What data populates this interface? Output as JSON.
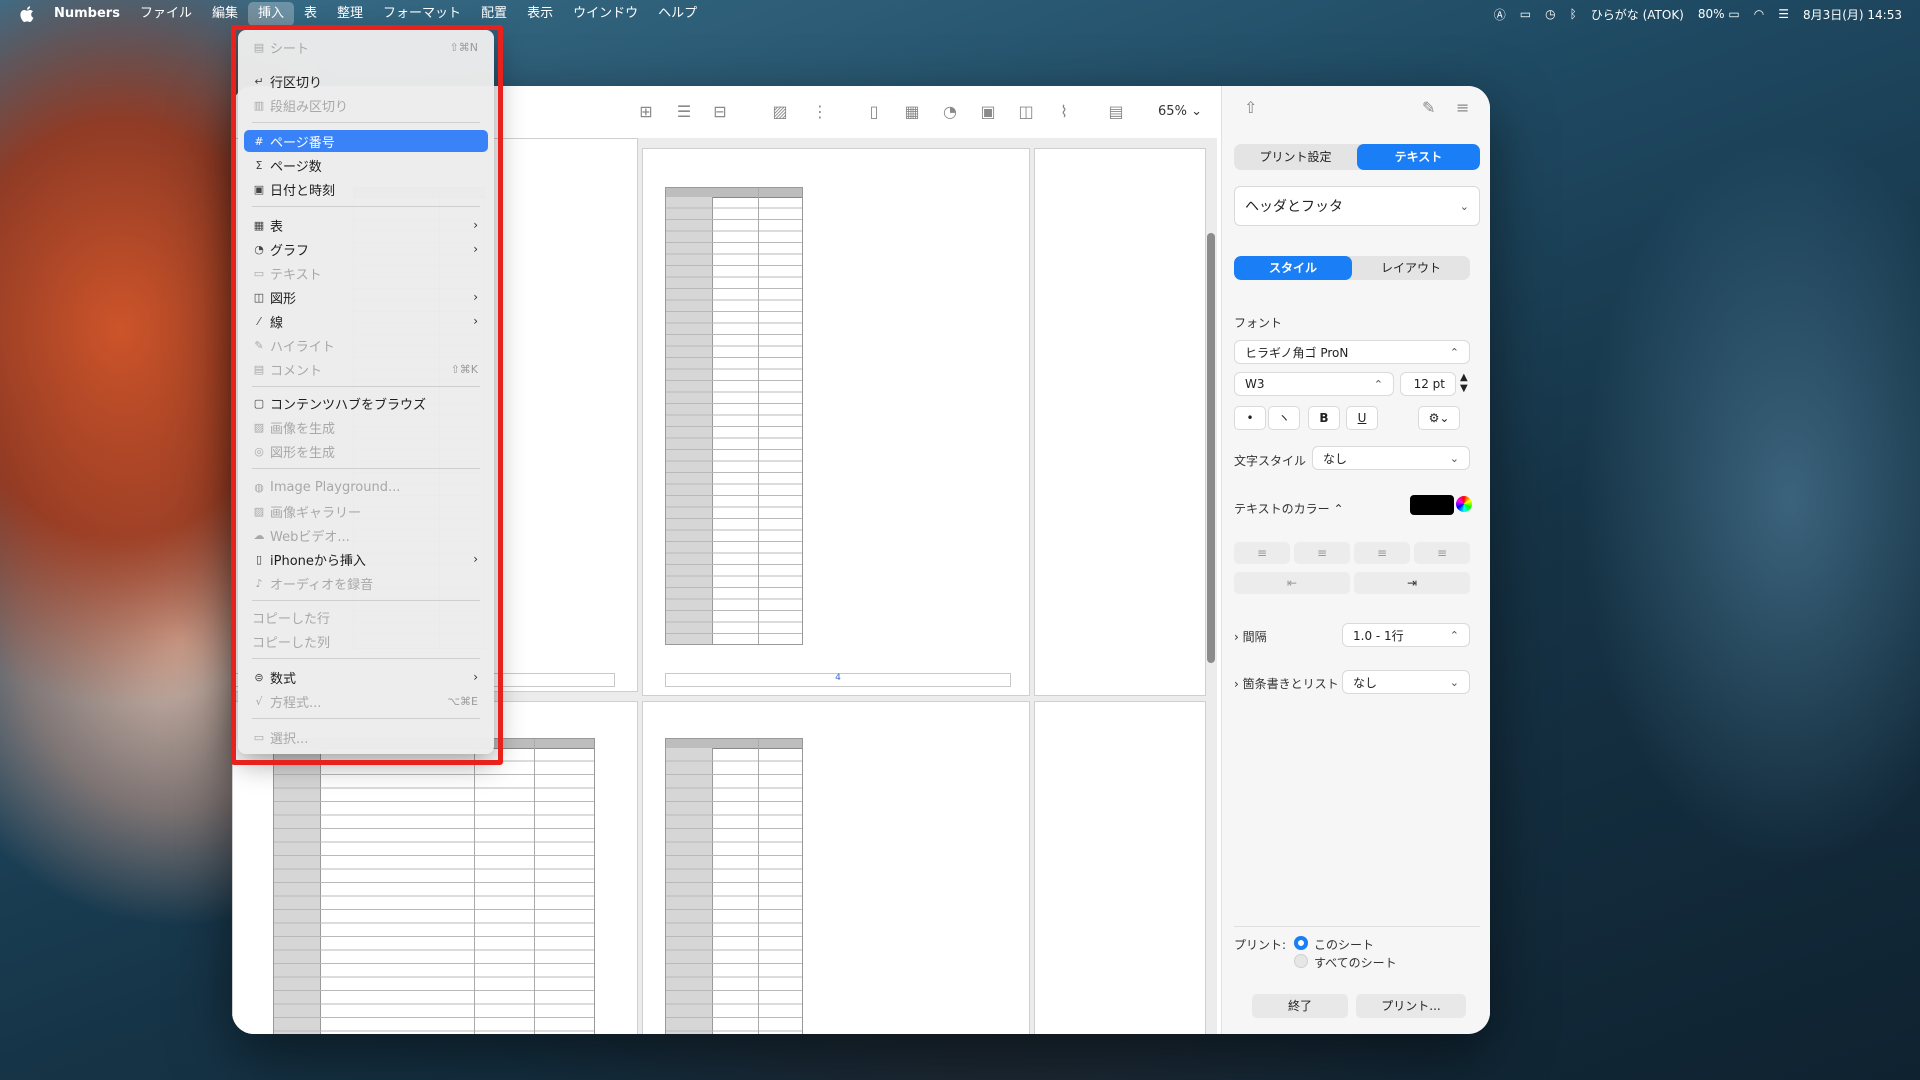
{
  "menubar": {
    "app": "Numbers",
    "items": [
      "ファイル",
      "編集",
      "挿入",
      "表",
      "整理",
      "フォーマット",
      "配置",
      "表示",
      "ウインドウ",
      "ヘルプ"
    ],
    "active_index": 2,
    "status": {
      "input_method": "ひらがな (ATOK)",
      "battery": "80%",
      "datetime": "8月3日(月)  14:53"
    }
  },
  "insert_menu": {
    "items": [
      {
        "label": "シート",
        "shortcut": "⇧⌘N",
        "disabled": true
      },
      {
        "label": "行区切り",
        "disabled": false
      },
      {
        "label": "段組み区切り",
        "disabled": true
      },
      {
        "label": "ページ番号",
        "disabled": false,
        "highlighted": true
      },
      {
        "label": "ページ数",
        "disabled": false
      },
      {
        "label": "日付と時刻",
        "disabled": false
      },
      {
        "label": "表",
        "submenu": true
      },
      {
        "label": "グラフ",
        "submenu": true
      },
      {
        "label": "テキスト",
        "disabled": true
      },
      {
        "label": "図形",
        "submenu": true
      },
      {
        "label": "線",
        "submenu": true
      },
      {
        "label": "ハイライト",
        "disabled": true
      },
      {
        "label": "コメント",
        "shortcut": "⇧⌘K",
        "disabled": true
      },
      {
        "label": "コンテンツハブをブラウズ"
      },
      {
        "label": "画像を生成",
        "disabled": true
      },
      {
        "label": "図形を生成",
        "disabled": true
      },
      {
        "label": "Image Playground...",
        "disabled": true
      },
      {
        "label": "画像ギャラリー",
        "disabled": true
      },
      {
        "label": "Webビデオ...",
        "disabled": true
      },
      {
        "label": "iPhoneから挿入",
        "submenu": true
      },
      {
        "label": "オーディオを録音",
        "disabled": true
      },
      {
        "label": "コピーした行",
        "disabled": true
      },
      {
        "label": "コピーした列",
        "disabled": true
      },
      {
        "label": "数式",
        "submenu": true
      },
      {
        "label": "方程式...",
        "shortcut": "⌥⌘E",
        "disabled": true
      },
      {
        "label": "選択...",
        "disabled": true
      }
    ]
  },
  "toolbar": {
    "zoom": "65%"
  },
  "document": {
    "page_number_label": "4"
  },
  "inspector": {
    "tabs": [
      "プリント設定",
      "テキスト"
    ],
    "active_tab": 1,
    "section_popup": "ヘッダとフッタ",
    "style_tabs": [
      "スタイル",
      "レイアウト"
    ],
    "font_label": "フォント",
    "font_name": "ヒラギノ角ゴ ProN",
    "font_weight": "W3",
    "font_size": "12 pt",
    "format_buttons": [
      "•",
      "ヽ",
      "B",
      "U"
    ],
    "char_style_label": "文字スタイル",
    "char_style_value": "なし",
    "text_color_label": "テキストのカラー ⌃",
    "text_color": "#000000",
    "spacing_label": "間隔",
    "spacing_value": "1.0 - 1行",
    "bullets_label": "箇条書きとリスト",
    "bullets_value": "なし",
    "print_label": "プリント:",
    "print_options": [
      "このシート",
      "すべてのシート"
    ],
    "done_button": "終了",
    "print_button": "プリント..."
  }
}
